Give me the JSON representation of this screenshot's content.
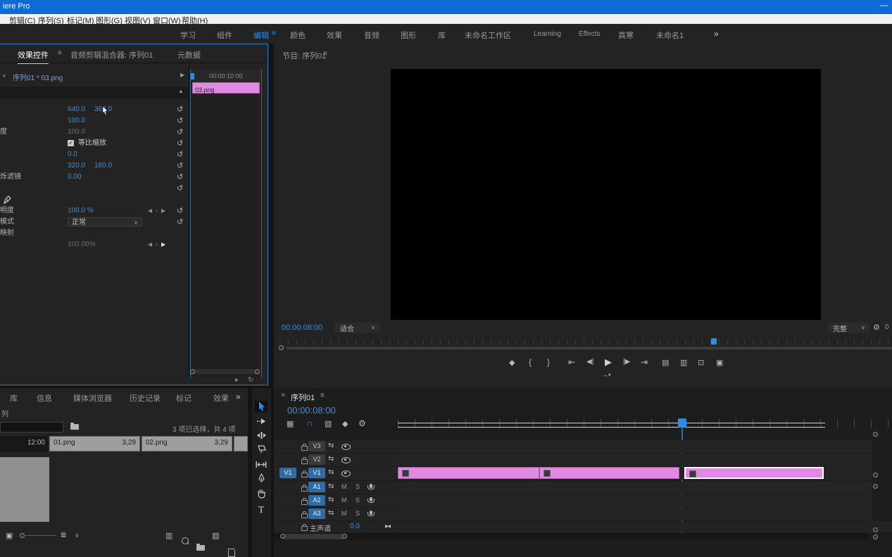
{
  "window": {
    "title": "iere Pro",
    "minimize_glyph": "—"
  },
  "menubar": {
    "items": [
      "剪辑(C)",
      "序列(S)",
      "标记(M)",
      "图形(G)",
      "视图(V)",
      "窗口(W)",
      "帮助(H)"
    ]
  },
  "workspaces": {
    "items": [
      "学习",
      "组件",
      "编辑",
      "颜色",
      "效果",
      "音频",
      "图形",
      "库",
      "未命名工作区",
      "Learning",
      "Effects",
      "真寒",
      "未命名1"
    ],
    "active": "编辑"
  },
  "glyphs": {
    "chev": "∨",
    "menu": "≡",
    "close": "×",
    "more": "»",
    "reset": "↺",
    "up": "▲",
    "play_right": "▶",
    "kf_prev": "◀",
    "kf_dot": "○",
    "kf_next": "▶",
    "check": "✓",
    "fit_in": "▸◂",
    "play_small": "▸",
    "loop": "↻",
    "sync": "⇆",
    "slider_knob": "○"
  },
  "effect_panel": {
    "tabs": [
      {
        "label": "效果控件",
        "active": true
      },
      {
        "label": "音频剪辑混合器: 序列01",
        "active": false
      },
      {
        "label": "元数据",
        "active": false
      }
    ],
    "header": {
      "title": "序列01 * 03.png"
    },
    "rows": [
      {
        "values": [
          "640.0",
          "360.0"
        ]
      },
      {
        "values": [
          "100.0"
        ]
      },
      {
        "fragment": "度",
        "values": [
          "100.0"
        ],
        "muted": true
      },
      {
        "checkbox_label": "等比缩放"
      },
      {
        "values": [
          "0.0"
        ]
      },
      {
        "values": [
          "320.0",
          "180.0"
        ]
      },
      {
        "fragment": "烁滤镜",
        "values": [
          "0.00"
        ]
      },
      {},
      {
        "pen": true
      },
      {
        "fragment": "明度",
        "values": [
          "100.0 %"
        ]
      },
      {
        "fragment": "模式",
        "dropdown": "正常"
      },
      {
        "fragment": "映射"
      },
      {
        "values": [
          "100.00%"
        ],
        "muted": true
      }
    ],
    "mini_timeline": {
      "ruler_label": "00:00:10:00",
      "clip_label": "03.png"
    }
  },
  "program_monitor": {
    "tab_label": "节目: 序列01",
    "timecode": "00:00:08:00",
    "fit_label": "适合",
    "quality_label": "完整",
    "duration_fragment": "0",
    "transport": [
      {
        "name": "add-marker-icon",
        "glyph": "◆"
      },
      {
        "name": "mark-in-icon",
        "glyph": "{"
      },
      {
        "name": "mark-out-icon",
        "glyph": "}"
      },
      {
        "name": "go-to-in-icon",
        "glyph": "⇤"
      },
      {
        "name": "step-back-icon",
        "glyph": "◀|"
      },
      {
        "name": "play-icon",
        "glyph": "▶"
      },
      {
        "name": "step-forward-icon",
        "glyph": "|▶"
      },
      {
        "name": "go-to-out-icon",
        "glyph": "⇥"
      },
      {
        "name": "lift-icon",
        "glyph": "▤"
      },
      {
        "name": "extract-icon",
        "glyph": "▥"
      },
      {
        "name": "export-frame-icon",
        "glyph": "⊡"
      },
      {
        "name": "comparison-view-icon",
        "glyph": "▣"
      }
    ],
    "insert_glyph": "→▪",
    "settings_glyph": "⚙"
  },
  "project_panel": {
    "tabs": [
      "库",
      "信息",
      "媒体浏览器",
      "历史记录",
      "标记",
      "效果"
    ],
    "overflow_glyph": "»",
    "fragment_label": "列",
    "status": "3 项已选择，共 4 项",
    "timecode_fragment": "12:00",
    "clips": [
      {
        "name": "01.png",
        "duration": "3,29"
      },
      {
        "name": "02.png",
        "duration": "3,29"
      }
    ],
    "toolbar": {
      "icon_view_glyph": "▣",
      "list_view_glyph": "≡",
      "view_chev_glyph": "∨",
      "automate_glyph": "▥",
      "new_item_glyph": "▨"
    }
  },
  "tools": {
    "type_label": "T"
  },
  "timeline": {
    "tab_label": "序列01",
    "timecode": "00:00:08:00",
    "toolbar": [
      {
        "name": "nest-icon",
        "glyph": "▦",
        "active": false
      },
      {
        "name": "snap-icon",
        "glyph": "∩",
        "active": true
      },
      {
        "name": "linked-selection-icon",
        "glyph": "▧",
        "active": false
      },
      {
        "name": "add-marker-icon",
        "glyph": "◆",
        "active": false
      },
      {
        "name": "timeline-settings-icon",
        "glyph": "⚙",
        "active": false
      }
    ],
    "video_tracks": [
      {
        "label": "V3",
        "targeted": false
      },
      {
        "label": "V2",
        "targeted": false
      },
      {
        "label": "V1",
        "targeted": true,
        "source_label": "V1"
      }
    ],
    "audio_tracks": [
      {
        "label": "A1",
        "targeted": true
      },
      {
        "label": "A2",
        "targeted": true
      },
      {
        "label": "A3",
        "targeted": true
      }
    ],
    "mute_label": "M",
    "solo_label": "S",
    "master": {
      "label": "主声道",
      "value": "0.0"
    }
  },
  "colors": {
    "accent": "#2d8ceb",
    "value_blue": "#3d8fd9",
    "clip_pink": "#e18ae1",
    "workarea_yellow": "#e6e64c",
    "titlebar_blue": "#0d6bd7"
  }
}
